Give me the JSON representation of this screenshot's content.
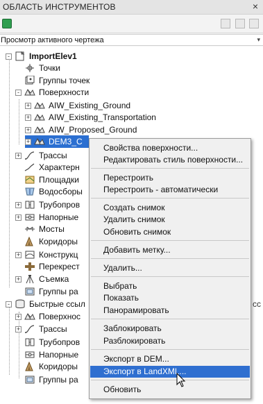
{
  "panel": {
    "title": "ОБЛАСТЬ ИНСТРУМЕНТОВ",
    "close_glyph": "×"
  },
  "view_selector": {
    "value": "Просмотр активного чертежа",
    "arrow": "▾"
  },
  "tree": [
    {
      "label": "ImportElev1",
      "bold": true,
      "icon": "drawing-icon",
      "expander": "-"
    },
    {
      "label": "Точки",
      "icon": "point-icon"
    },
    {
      "label": "Группы точек",
      "icon": "point-group-icon"
    },
    {
      "label": "Поверхности",
      "icon": "surface-icon",
      "expander": "-"
    },
    {
      "label": "AIW_Existing_Ground",
      "icon": "surface-item-icon",
      "expander": "+"
    },
    {
      "label": "AIW_Existing_Transportation",
      "icon": "surface-item-icon",
      "expander": "+"
    },
    {
      "label": "AIW_Proposed_Ground",
      "icon": "surface-item-icon",
      "expander": "+"
    },
    {
      "label": "DEM3_C",
      "icon": "surface-item-icon",
      "expander": "+",
      "selected": true
    },
    {
      "label": "Трассы",
      "icon": "alignment-icon",
      "expander": "+"
    },
    {
      "label": "Характерн",
      "icon": "feature-line-icon"
    },
    {
      "label": "Площадки",
      "icon": "site-icon"
    },
    {
      "label": "Водосборы",
      "icon": "catchment-icon"
    },
    {
      "label": "Трубопров",
      "icon": "pipe-network-icon",
      "expander": "+"
    },
    {
      "label": "Напорные",
      "icon": "pressure-network-icon",
      "expander": "+"
    },
    {
      "label": "Мосты",
      "icon": "bridge-icon"
    },
    {
      "label": "Коридоры",
      "icon": "corridor-icon"
    },
    {
      "label": "Конструкц",
      "icon": "assembly-icon",
      "expander": "+"
    },
    {
      "label": "Перекрест",
      "icon": "intersection-icon"
    },
    {
      "label": "Съемка",
      "icon": "survey-icon",
      "expander": "+"
    },
    {
      "label": "Группы ра",
      "icon": "view-frame-icon"
    },
    {
      "label": "Быстрые ссыл",
      "icon": "data-shortcuts-icon",
      "expander": "-"
    },
    {
      "label": "Поверхнос",
      "icon": "surface-icon",
      "expander": "+"
    },
    {
      "label": "Трассы",
      "icon": "alignment-icon",
      "expander": "+"
    },
    {
      "label": "Трубопров",
      "icon": "pipe-network-icon"
    },
    {
      "label": "Напорные",
      "icon": "pressure-network-icon"
    },
    {
      "label": "Коридоры",
      "icon": "corridor-icon"
    },
    {
      "label": "Группы ра",
      "icon": "view-frame-icon"
    }
  ],
  "context_menu": [
    {
      "label": "Свойства поверхности..."
    },
    {
      "label": "Редактировать стиль поверхности..."
    },
    {
      "label": "Перестроить"
    },
    {
      "label": "Перестроить - автоматически"
    },
    {
      "label": "Создать снимок"
    },
    {
      "label": "Удалить снимок"
    },
    {
      "label": "Обновить снимок"
    },
    {
      "label": "Добавить метку..."
    },
    {
      "label": "Удалить..."
    },
    {
      "label": "Выбрать"
    },
    {
      "label": "Показать"
    },
    {
      "label": "Панорамировать"
    },
    {
      "label": "Заблокировать"
    },
    {
      "label": "Разблокировать"
    },
    {
      "label": "Экспорт в DEM..."
    },
    {
      "label": "Экспорт в LandXML...",
      "highlighted": true
    },
    {
      "label": "Обновить"
    }
  ],
  "trailing_text": "сс",
  "colors": {
    "selection": "#2b6fd1",
    "menu_highlight": "#2f6fd0",
    "menu_bg": "#f0f0f0"
  }
}
